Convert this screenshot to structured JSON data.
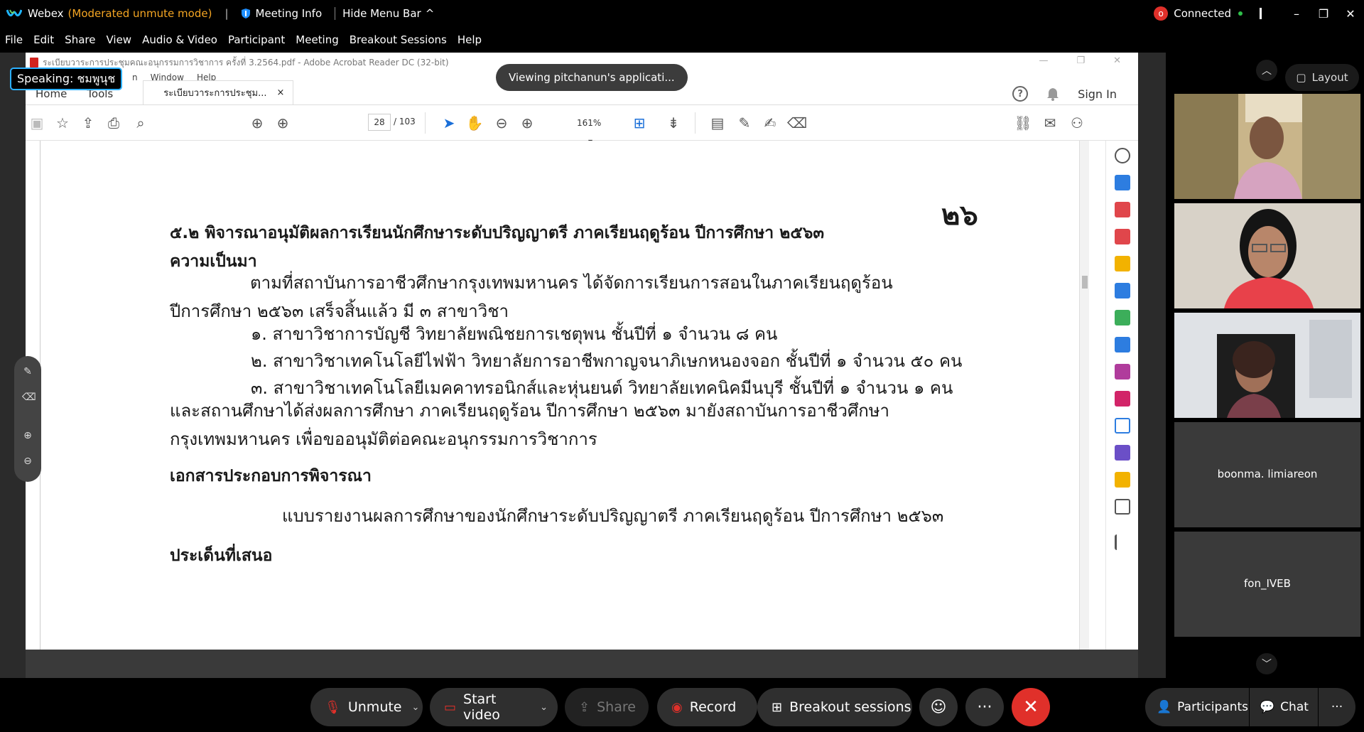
{
  "topbar": {
    "app_name": "Webex",
    "app_mode": "(Moderated unmute mode)",
    "separator": "|",
    "meeting_info": "Meeting Info",
    "hide_menu": "Hide Menu Bar",
    "hide_menu_chevron": "^",
    "rec_indicator": "o",
    "connected": "Connected",
    "window_controls": [
      "–",
      "❐",
      "✕"
    ]
  },
  "menubar": {
    "items": [
      "File",
      "Edit",
      "Share",
      "View",
      "Audio & Video",
      "Participant",
      "Meeting",
      "Breakout Sessions",
      "Help"
    ]
  },
  "shared_app": {
    "viewing_label": "Viewing pitchanun's applicati...",
    "speaking_label": "Speaking: ชมพูนุช",
    "acrobat": {
      "window_title": "ระเบียบวาระการประชุมคณะอนุกรรมการวิชาการ ครั้งที่ 3.2564.pdf - Adobe Acrobat Reader DC (32-bit)",
      "menu_items": [
        "n",
        "Window",
        "Help"
      ],
      "tabs": {
        "home": "Home",
        "tools": "Tools",
        "doc_tab": "ระเบียบวาระการประชุม...",
        "doc_tab_close": "×"
      },
      "sign_in": "Sign In",
      "help_icon": "?",
      "page_current": "28",
      "page_total": "/ 103",
      "zoom": "161%",
      "zoom_caret": "▾"
    },
    "document": {
      "page_number": "๒๖",
      "heading": "๕.๒  พิจารณาอนุมัติผลการเรียนนักศึกษาระดับปริญญาตรี ภาคเรียนฤดูร้อน ปีการศึกษา ๒๕๖๓",
      "subheading": "ความเป็นมา",
      "para1_line1": "ตามที่สถาบันการอาชีวศึกษากรุงเทพมหานคร ได้จัดการเรียนการสอนในภาคเรียนฤดูร้อน",
      "para1_line2": "ปีการศึกษา ๒๕๖๓ เสร็จสิ้นแล้ว มี ๓ สาขาวิชา",
      "item1": "๑.  สาขาวิชาการบัญชี  วิทยาลัยพณิชยการเชตุพน  ชั้นปีที่ ๑  จำนวน  ๘  คน",
      "item2": "๒.  สาขาวิชาเทคโนโลยีไฟฟ้า  วิทยาลัยการอาชีพกาญจนาภิเษกหนองจอก  ชั้นปีที่ ๑  จำนวน ๕๐ คน",
      "item3": "๓.  สาขาวิชาเทคโนโลยีเมคคาทรอนิกส์และหุ่นยนต์ วิทยาลัยเทคนิคมีนบุรี ชั้นปีที่ ๑ จำนวน  ๑  คน",
      "para2_line1": "และสถานศึกษาได้ส่งผลการศึกษา ภาคเรียนฤดูร้อน  ปีการศึกษา ๒๕๖๓ มายังสถาบันการอาชีวศึกษา",
      "para2_line2": "กรุงเทพมหานคร เพื่อขออนุมัติต่อคณะอนุกรรมการวิชาการ",
      "subheading2": "เอกสารประกอบการพิจารณา",
      "attachment": "แบบรายงานผลการศึกษาของนักศึกษาระดับปริญญาตรี ภาคเรียนฤดูร้อน  ปีการศึกษา ๒๕๖๓",
      "subheading3": "ประเด็นที่เสนอ"
    }
  },
  "panel": {
    "layout_label": "Layout",
    "participants": [
      {
        "name": "",
        "video": true
      },
      {
        "name": "",
        "video": true
      },
      {
        "name": "",
        "video": true
      },
      {
        "name": "boonma. limiareon",
        "video": false
      },
      {
        "name": "fon_IVEB",
        "video": false
      }
    ]
  },
  "controls": {
    "unmute": "Unmute",
    "start_video": "Start video",
    "share": "Share",
    "record": "Record",
    "breakout": "Breakout sessions",
    "participants": "Participants",
    "chat": "Chat",
    "more": "···",
    "end_icon": "✕"
  },
  "colors": {
    "accent_blue": "#2bb0ff",
    "end_red": "#e0302a",
    "mode_orange": "#f5a623",
    "connected_green": "#2fbf4a"
  }
}
